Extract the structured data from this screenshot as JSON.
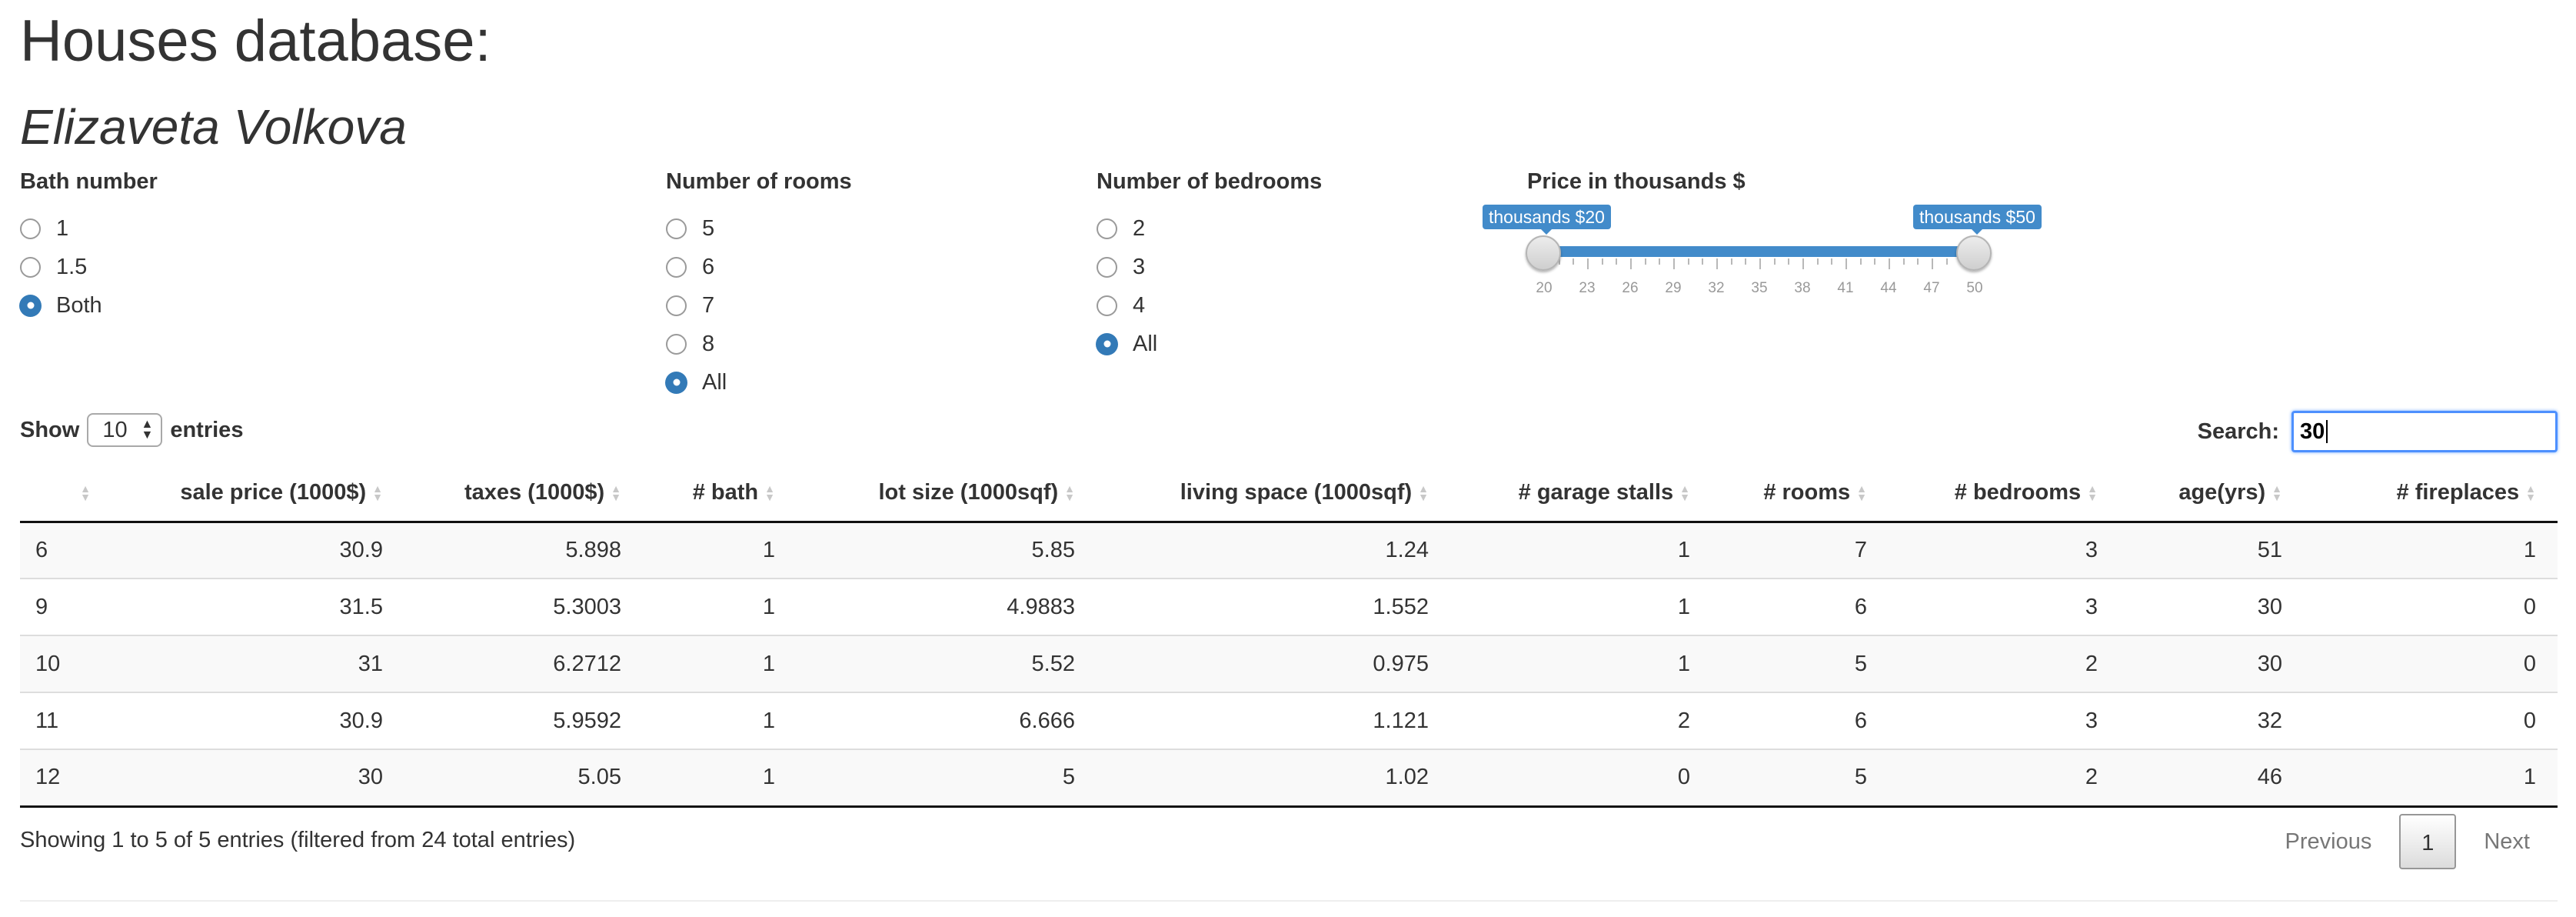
{
  "page": {
    "title": "Houses database:",
    "author": "Elizaveta Volkova"
  },
  "filters": {
    "bath": {
      "label": "Bath number",
      "options": [
        "1",
        "1.5",
        "Both"
      ],
      "selected": "Both"
    },
    "rooms": {
      "label": "Number of rooms",
      "options": [
        "5",
        "6",
        "7",
        "8",
        "All"
      ],
      "selected": "All"
    },
    "bedrooms": {
      "label": "Number of bedrooms",
      "options": [
        "2",
        "3",
        "4",
        "All"
      ],
      "selected": "All"
    },
    "price": {
      "label": "Price in thousands $",
      "min": 20,
      "max": 50,
      "low": 20,
      "high": 50,
      "low_label": "thousands $20",
      "high_label": "thousands $50",
      "tick_labels": [
        "20",
        "23",
        "26",
        "29",
        "32",
        "35",
        "38",
        "41",
        "44",
        "47",
        "50"
      ]
    }
  },
  "controls": {
    "show_label": "Show",
    "entries_label": "entries",
    "page_length": "10",
    "search_label": "Search:",
    "search_value": "30"
  },
  "table": {
    "columns": [
      "",
      "sale price (1000$)",
      "taxes (1000$)",
      "# bath",
      "lot size (1000sqf)",
      "living space (1000sqf)",
      "# garage stalls",
      "# rooms",
      "# bedrooms",
      "age(yrs)",
      "# fireplaces"
    ],
    "rows": [
      [
        "6",
        "30.9",
        "5.898",
        "1",
        "5.85",
        "1.24",
        "1",
        "7",
        "3",
        "51",
        "1"
      ],
      [
        "9",
        "31.5",
        "5.3003",
        "1",
        "4.9883",
        "1.552",
        "1",
        "6",
        "3",
        "30",
        "0"
      ],
      [
        "10",
        "31",
        "6.2712",
        "1",
        "5.52",
        "0.975",
        "1",
        "5",
        "2",
        "30",
        "0"
      ],
      [
        "11",
        "30.9",
        "5.9592",
        "1",
        "6.666",
        "1.121",
        "2",
        "6",
        "3",
        "32",
        "0"
      ],
      [
        "12",
        "30",
        "5.05",
        "1",
        "5",
        "1.02",
        "0",
        "5",
        "2",
        "46",
        "1"
      ]
    ]
  },
  "footer": {
    "info": "Showing 1 to 5 of 5 entries (filtered from 24 total entries)",
    "previous": "Previous",
    "current_page": "1",
    "next": "Next"
  },
  "colors": {
    "accent": "#428bca",
    "radio_checked": "#337ab7",
    "focus": "#4d90fe"
  }
}
